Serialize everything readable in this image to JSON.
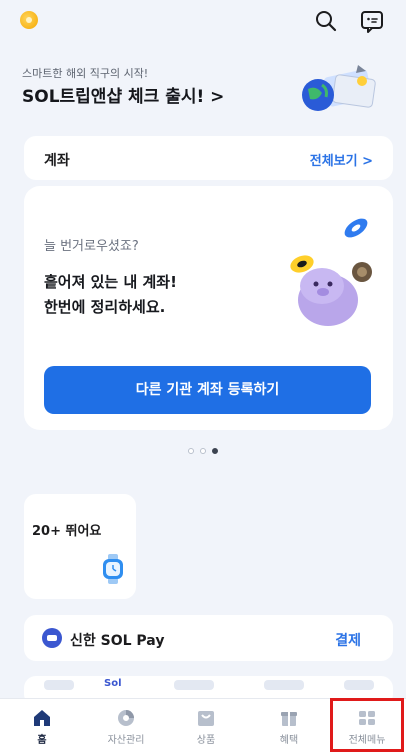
{
  "topbar": {
    "logo_icon": "shinhan-sol-logo",
    "search_icon": "search-icon",
    "chat_icon": "chat-icon"
  },
  "banner": {
    "subtitle": "스마트한 해외 직구의 시작!",
    "title": "SOL트립앤샵 체크 출시! >"
  },
  "account_header": {
    "title": "계좌",
    "view_all": "전체보기 >"
  },
  "account_card": {
    "subtitle": "늘 번거로우셨죠?",
    "message_line1": "흩어져 있는 내 계좌!",
    "message_line2": "한번에 정리하세요.",
    "button": "다른 기관 계좌 등록하기"
  },
  "carousel": {
    "count": 3,
    "active_index": 2
  },
  "widget": {
    "label": "20+ 뛰어요"
  },
  "pay": {
    "label": "신한 SOL Pay",
    "action": "결제"
  },
  "peek": {
    "text": "Sol"
  },
  "tabs": [
    {
      "label": "홈",
      "icon": "home-icon",
      "active": true
    },
    {
      "label": "자산관리",
      "icon": "asset-chart-icon",
      "active": false
    },
    {
      "label": "상품",
      "icon": "product-box-icon",
      "active": false
    },
    {
      "label": "혜택",
      "icon": "gift-icon",
      "active": false
    },
    {
      "label": "전체메뉴",
      "icon": "grid-menu-icon",
      "active": false
    }
  ],
  "colors": {
    "accent": "#1f6fe5",
    "link": "#2b73e6",
    "background": "#f1f4fa",
    "highlight": "#e01a1a"
  }
}
